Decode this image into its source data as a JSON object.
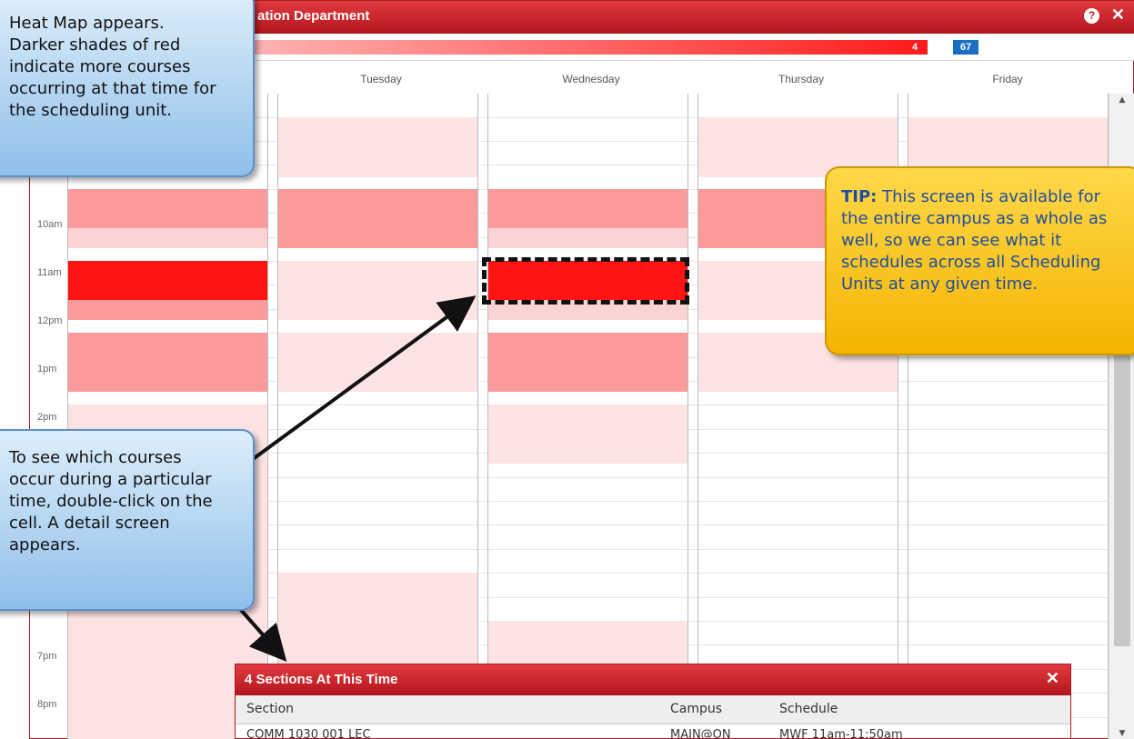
{
  "window": {
    "title": "ation Department",
    "help_icon": "?",
    "close_icon": "✕"
  },
  "legend": {
    "max_value": "4",
    "total_badge": "67",
    "gradient_from": "#fde6e6",
    "gradient_to": "#ff1a1a"
  },
  "days": [
    "Tuesday",
    "Wednesday",
    "Thursday",
    "Friday"
  ],
  "time_labels": [
    "10am",
    "11am",
    "12pm",
    "1pm",
    "2pm",
    "7pm",
    "8pm"
  ],
  "callouts": {
    "heatmap": "Heat Map appears.\nDarker shades of red\nindicate more courses\noccurring at that time for\nthe scheduling unit.",
    "doubleclick": "To see which courses\noccur during a particular\ntime, double-click on the\ncell. A detail screen\nappears."
  },
  "tip": {
    "label": "TIP:",
    "text": " This screen is available for the entire campus as a whole as well, so we can see what it schedules across all Scheduling Units at any given time."
  },
  "detail": {
    "title": "4 Sections At This Time",
    "close_icon": "✕",
    "columns": {
      "section": "Section",
      "campus": "Campus",
      "schedule": "Schedule"
    },
    "rows": [
      {
        "section": "COMM 1030 001 LEC",
        "campus": "MAIN@ON",
        "schedule": "MWF 11am-11:50am"
      }
    ]
  },
  "scroll": {
    "up_icon": "▲",
    "down_icon": "▼"
  }
}
